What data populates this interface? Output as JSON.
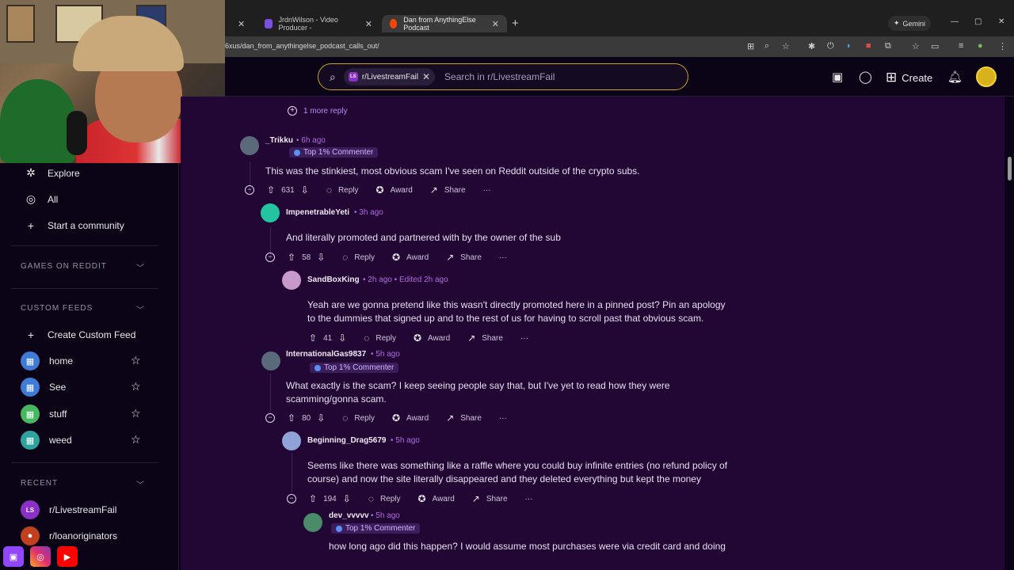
{
  "browser": {
    "tabs": [
      {
        "label": ""
      },
      {
        "label": "JrdnWilson - Video Producer -"
      },
      {
        "label": "Dan from AnythingElse Podcast"
      }
    ],
    "gemini_label": "Gemini",
    "url": "6xus/dan_from_anythingelse_podcast_calls_out/"
  },
  "header": {
    "subreddit_chip": "r/LivestreamFail",
    "search_placeholder": "Search in r/LivestreamFail",
    "create_label": "Create"
  },
  "sidebar": {
    "top_items": [
      {
        "label": "Explore",
        "icon": "explore-icon"
      },
      {
        "label": "All",
        "icon": "all-icon"
      },
      {
        "label": "Start a community",
        "icon": "plus-icon"
      }
    ],
    "games_heading": "GAMES ON REDDIT",
    "custom_feeds_heading": "CUSTOM FEEDS",
    "create_feed_label": "Create Custom Feed",
    "feeds": [
      {
        "label": "home",
        "color": "#3e7bd6"
      },
      {
        "label": "See",
        "color": "#3e7bd6"
      },
      {
        "label": "stuff",
        "color": "#46b860"
      },
      {
        "label": "weed",
        "color": "#2ea39e"
      }
    ],
    "recent_heading": "RECENT",
    "recent": [
      {
        "label": "r/LivestreamFail",
        "color": "#8b2fc9"
      },
      {
        "label": "r/loanoriginators",
        "color": "#c2401f"
      }
    ]
  },
  "comments": {
    "more_replies": "1 more reply",
    "items": [
      {
        "user": "_Trikku",
        "time": "6h ago",
        "flair": "Top 1% Commenter",
        "body": "This was the stinkiest, most obvious scam I've seen on Reddit outside of the crypto subs.",
        "votes": "631"
      },
      {
        "user": "ImpenetrableYeti",
        "time": "3h ago",
        "body": "And literally promoted and partnered with by the owner of the sub",
        "votes": "58"
      },
      {
        "user": "SandBoxKing",
        "time": "2h ago",
        "edited": "Edited 2h ago",
        "body1": "Yeah are we gonna pretend like this wasn't directly promoted here in a pinned post? Pin an apology",
        "body2": "to the dummies that signed up and to the rest of us for having to scroll past that obvious scam.",
        "votes": "41"
      },
      {
        "user": "InternationalGas9837",
        "time": "5h ago",
        "flair": "Top 1% Commenter",
        "body1": "What exactly is the scam? I keep seeing people say that, but I've yet to read how they were",
        "body2": "scamming/gonna scam.",
        "votes": "80"
      },
      {
        "user": "Beginning_Drag5679",
        "time": "5h ago",
        "body1": "Seems like there was something like a raffle where you could buy infinite entries (no refund policy of",
        "body2": "course) and now the site literally disappeared and they deleted everything but kept the money",
        "votes": "194"
      },
      {
        "user": "dev_vvvvv",
        "time": "5h ago",
        "flair": "Top 1% Commenter",
        "body1": "how long ago did this happen? I would assume most purchases were via credit card and doing"
      }
    ],
    "action_labels": {
      "reply": "Reply",
      "award": "Award",
      "share": "Share",
      "more": "···"
    }
  }
}
